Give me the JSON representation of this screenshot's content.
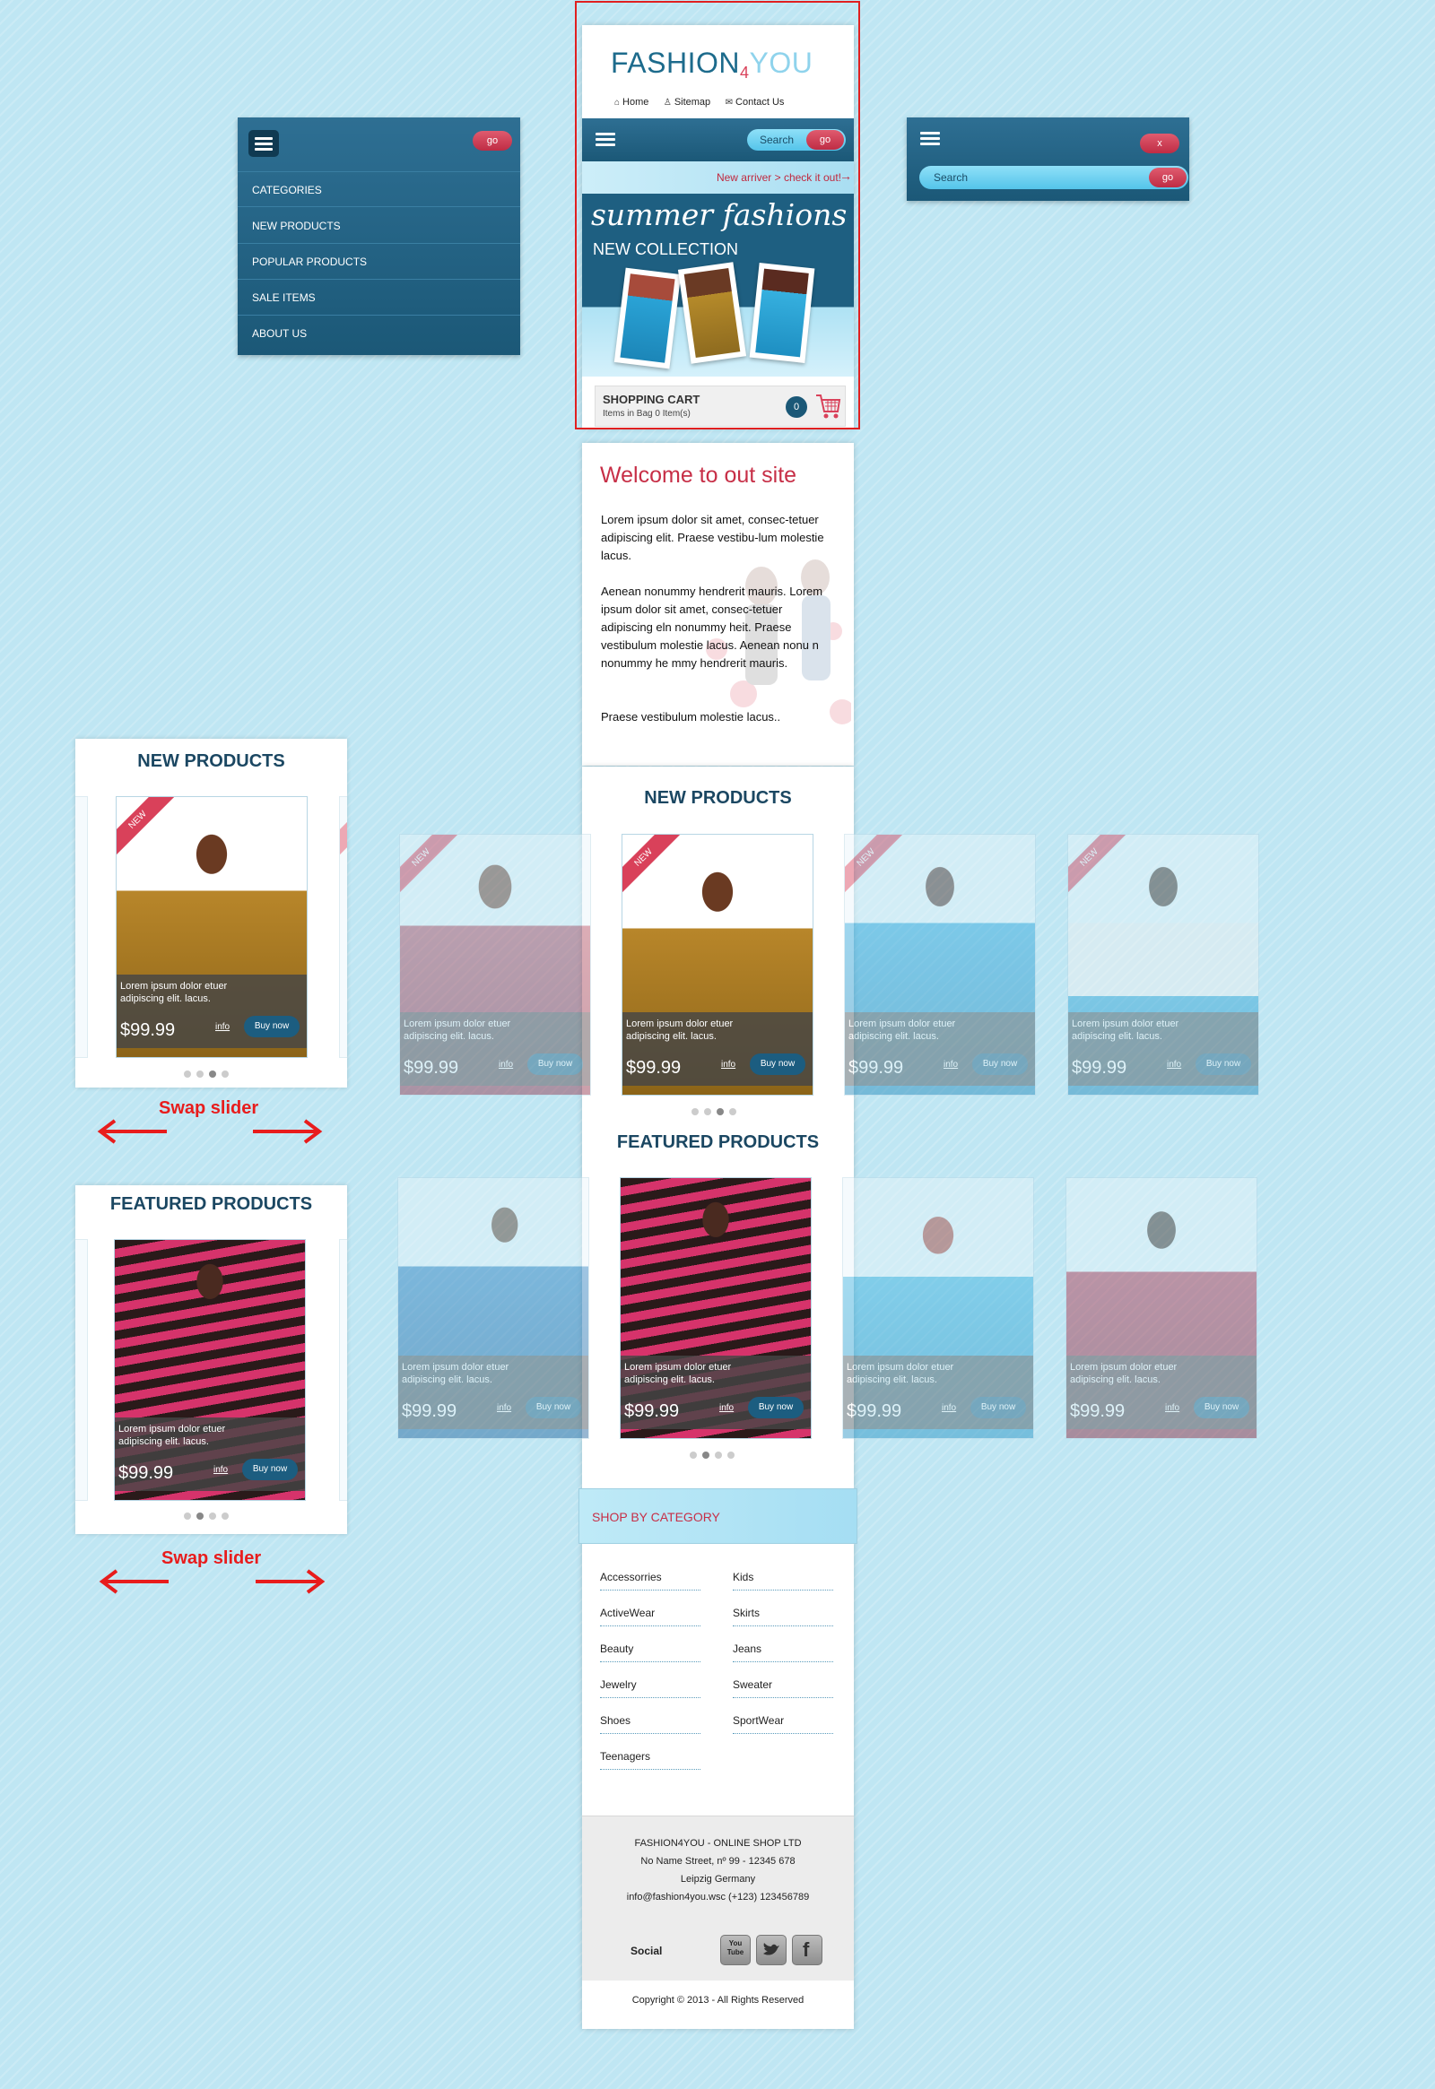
{
  "header": {
    "logo_fashion": "FASHION",
    "logo_four": "4",
    "logo_you": "YOU",
    "nav": [
      "Home",
      "Sitemap",
      "Contact Us"
    ],
    "search_label": "Search",
    "go_label": "go",
    "new_arrival": "New arriver > check it out!"
  },
  "banner": {
    "title": "summer fashions",
    "subtitle": "NEW COLLECTION"
  },
  "cart": {
    "title": "SHOPPING CART",
    "status": "Items in Bag 0 Item(s)",
    "count": "0"
  },
  "side_menu": {
    "go_label": "go",
    "items": [
      "CATEGORIES",
      "NEW PRODUCTS",
      "POPULAR PRODUCTS",
      "SALE ITEMS",
      "ABOUT US"
    ]
  },
  "search_panel": {
    "close_label": "x",
    "search_label": "Search",
    "go_label": "go"
  },
  "welcome": {
    "title": "Welcome to out site",
    "para1": "Lorem ipsum dolor sit amet, consec-tetuer adipiscing elit. Praese vestibu-lum molestie lacus.",
    "para2": "Aenean nonummy hendrerit mauris. Lorem ipsum dolor sit amet, consec-tetuer adipiscing eln nonummy heit. Praese vestibulum molestie lacus. Aenean nonu n nonummy he mmy hendrerit mauris.",
    "para3": "Praese vestibulum molestie lacus.."
  },
  "new_products": {
    "title": "NEW PRODUCTS",
    "ribbon": "NEW",
    "desc": "Lorem ipsum dolor etuer adipiscing elit. lacus.",
    "price": "$99.99",
    "info": "info",
    "buy": "Buy now"
  },
  "featured_products": {
    "title": "FEATURED PRODUCTS",
    "desc": "Lorem ipsum dolor etuer adipiscing elit. lacus.",
    "price": "$99.99",
    "info": "info",
    "buy": "Buy now"
  },
  "annotation": {
    "swap": "Swap slider"
  },
  "shop_by_category": {
    "title": "SHOP BY CATEGORY",
    "left": [
      "Accessorries",
      "ActiveWear",
      "Beauty",
      "Jewelry",
      "Shoes",
      "Teenagers"
    ],
    "right": [
      "Kids",
      "Skirts",
      "Jeans",
      "Sweater",
      "SportWear"
    ]
  },
  "footer": {
    "company": "FASHION4YOU - ONLINE SHOP LTD",
    "street": "No Name Street, nº 99 - 12345 678",
    "city": "Leipzig  Germany",
    "contact": "info@fashion4you.wsc  (+123) 123456789",
    "social_label": "Social",
    "social_icons": [
      "youtube-icon",
      "twitter-icon",
      "facebook-icon"
    ],
    "youtube_text": "You Tube",
    "facebook_text": "f",
    "copyright": "Copyright © 2013 - All Rights Reserved"
  },
  "colors": {
    "brand_dark": "#1b5877",
    "accent_red": "#d9415a",
    "background": "#bfe6f3"
  }
}
